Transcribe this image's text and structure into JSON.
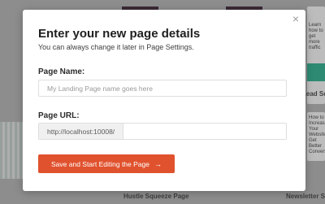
{
  "background": {
    "template_labels": [
      "Lead Squ",
      "Hustle Squeeze Page",
      "Newsletter Squeez"
    ],
    "thumb_text": [
      "How to Increase Your Website Get Better Conversions",
      "Learn how to get more traffic"
    ]
  },
  "modal": {
    "close_icon": "×",
    "title": "Enter your new page details",
    "subtitle": "You can always change it later in Page Settings.",
    "page_name": {
      "label": "Page Name:",
      "value": "",
      "placeholder": "My Landing Page name goes here"
    },
    "page_url": {
      "label": "Page URL:",
      "prefix": "http://localhost:10008/",
      "value": ""
    },
    "submit": {
      "label": "Save and Start Editing the Page",
      "arrow": "→"
    }
  },
  "colors": {
    "accent": "#e0522e",
    "overlay": "#8d8d8d"
  }
}
